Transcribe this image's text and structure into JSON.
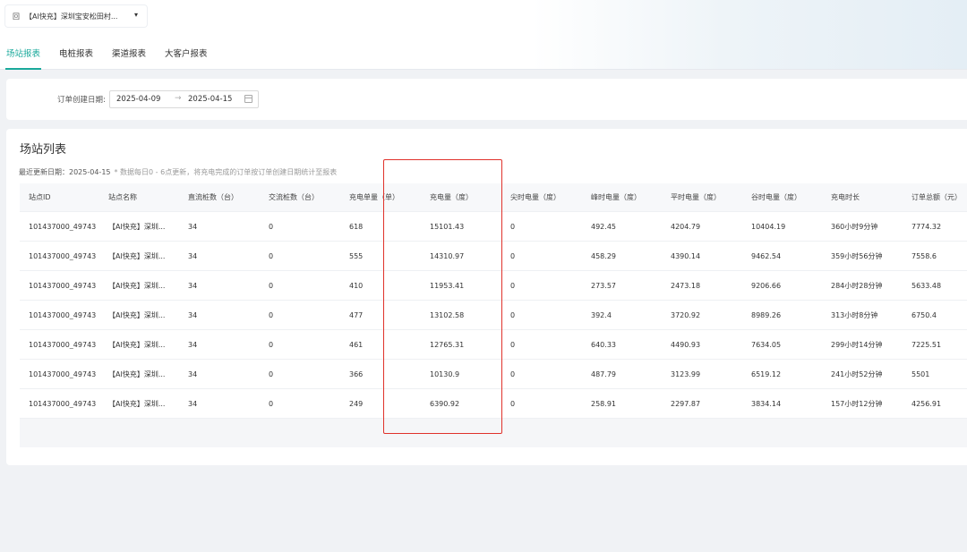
{
  "header": {
    "station_icon": "building-icon",
    "station_icon_glyph": "回",
    "station_name": "【AI快充】深圳宝安松田村...",
    "caret": "▾"
  },
  "tabs": [
    {
      "label": "场站报表",
      "active": true
    },
    {
      "label": "电桩报表",
      "active": false
    },
    {
      "label": "渠道报表",
      "active": false
    },
    {
      "label": "大客户报表",
      "active": false
    }
  ],
  "filter": {
    "label": "订单创建日期:",
    "start_date": "2025-04-09",
    "arrow": "→",
    "end_date": "2025-04-15"
  },
  "list": {
    "title": "场站列表",
    "update_label": "最近更新日期：",
    "update_date": "2025-04-15",
    "note": "* 数据每日0 - 6点更新，将充电完成的订单按订单创建日期统计至报表"
  },
  "table": {
    "columns": [
      "站点ID",
      "站点名称",
      "直流桩数（台）",
      "交流桩数（台）",
      "充电单量（单）",
      "充电量（度）",
      "尖时电量（度）",
      "峰时电量（度）",
      "平时电量（度）",
      "谷时电量（度）",
      "充电时长",
      "订单总额（元）"
    ],
    "rows": [
      [
        "101437000_49743",
        "【AI快充】深圳...",
        "34",
        "0",
        "618",
        "15101.43",
        "0",
        "492.45",
        "4204.79",
        "10404.19",
        "360小时9分钟",
        "7774.32"
      ],
      [
        "101437000_49743",
        "【AI快充】深圳...",
        "34",
        "0",
        "555",
        "14310.97",
        "0",
        "458.29",
        "4390.14",
        "9462.54",
        "359小时56分钟",
        "7558.6"
      ],
      [
        "101437000_49743",
        "【AI快充】深圳...",
        "34",
        "0",
        "410",
        "11953.41",
        "0",
        "273.57",
        "2473.18",
        "9206.66",
        "284小时28分钟",
        "5633.48"
      ],
      [
        "101437000_49743",
        "【AI快充】深圳...",
        "34",
        "0",
        "477",
        "13102.58",
        "0",
        "392.4",
        "3720.92",
        "8989.26",
        "313小时8分钟",
        "6750.4"
      ],
      [
        "101437000_49743",
        "【AI快充】深圳...",
        "34",
        "0",
        "461",
        "12765.31",
        "0",
        "640.33",
        "4490.93",
        "7634.05",
        "299小时14分钟",
        "7225.51"
      ],
      [
        "101437000_49743",
        "【AI快充】深圳...",
        "34",
        "0",
        "366",
        "10130.9",
        "0",
        "487.79",
        "3123.99",
        "6519.12",
        "241小时52分钟",
        "5501"
      ],
      [
        "101437000_49743",
        "【AI快充】深圳...",
        "34",
        "0",
        "249",
        "6390.92",
        "0",
        "258.91",
        "2297.87",
        "3834.14",
        "157小时12分钟",
        "4256.91"
      ]
    ]
  },
  "colors": {
    "accent": "#1aa99b",
    "highlight": "#e0322b"
  }
}
